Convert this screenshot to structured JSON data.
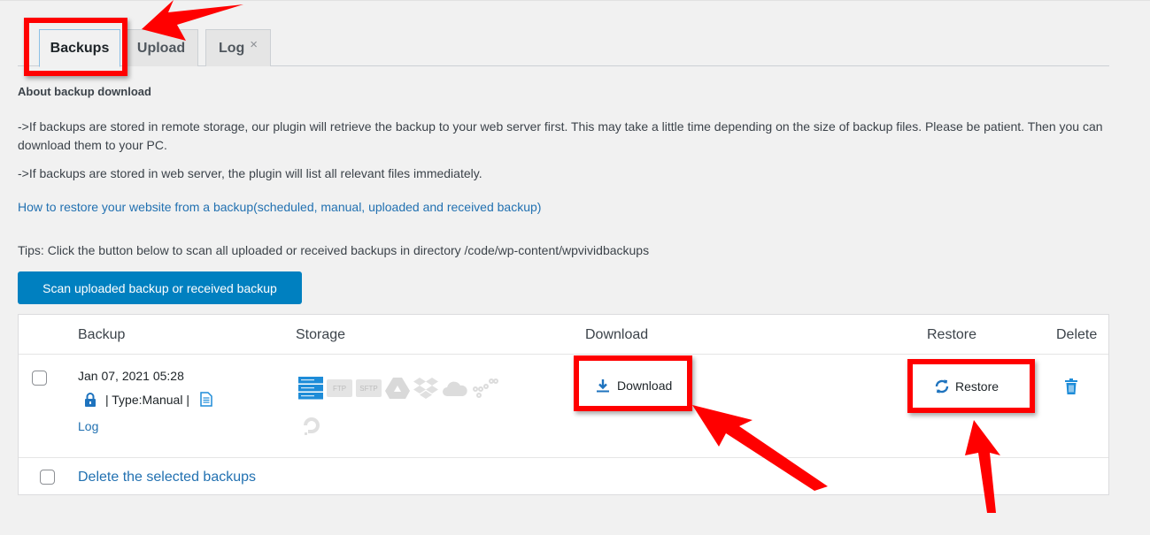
{
  "tabs": [
    {
      "label": "Backups",
      "active": true
    },
    {
      "label": "Upload",
      "active": false
    },
    {
      "label": "Log",
      "active": false,
      "closable": true,
      "close_glyph": "×"
    }
  ],
  "about": {
    "title": "About backup download",
    "para1": "->If backups are stored in remote storage, our plugin will retrieve the backup to your web server first. This may take a little time depending on the size of backup files. Please be patient. Then you can download them to your PC.",
    "para2": "->If backups are stored in web server, the plugin will list all relevant files immediately.",
    "howto_link": "How to restore your website from a backup(scheduled, manual, uploaded and received backup)"
  },
  "tips": "Tips: Click the button below to scan all uploaded or received backups in directory /code/wp-content/wpvividbackups",
  "scan_button": "Scan uploaded backup or received backup",
  "table": {
    "headers": {
      "backup": "Backup",
      "storage": "Storage",
      "download": "Download",
      "restore": "Restore",
      "delete": "Delete"
    },
    "rows": [
      {
        "date": "Jan 07, 2021 05:28",
        "type": "| Type:Manual |",
        "log": "Log",
        "storage_icons": [
          "local-server",
          "ftp",
          "sftp",
          "google-drive",
          "dropbox",
          "onedrive",
          "s3-compat",
          "digitalocean"
        ],
        "storage_labels": {
          "ftp": "FTP",
          "sftp": "SFTP"
        },
        "download_label": "Download",
        "restore_label": "Restore"
      }
    ],
    "footer_link": "Delete the selected backups"
  },
  "colors": {
    "accent": "#0080c0",
    "link": "#2271b1",
    "annotation": "#ff0000"
  }
}
